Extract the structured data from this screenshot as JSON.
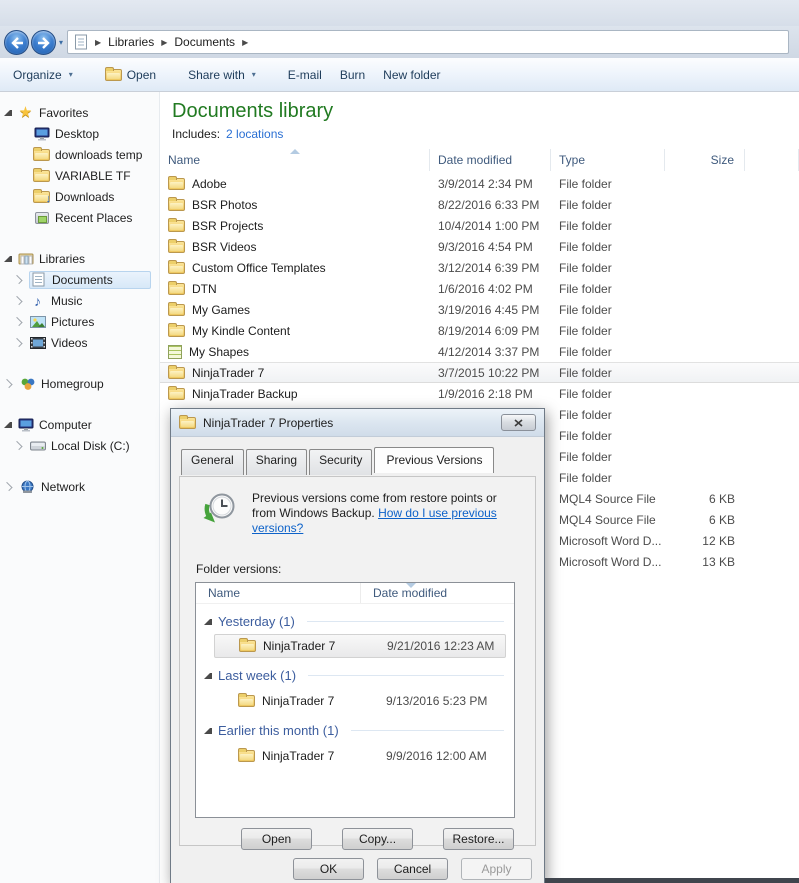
{
  "breadcrumb": {
    "items": [
      "Libraries",
      "Documents"
    ]
  },
  "toolbar": {
    "organize": "Organize",
    "open": "Open",
    "share": "Share with",
    "email": "E-mail",
    "burn": "Burn",
    "new_folder": "New folder"
  },
  "sidebar": {
    "favorites": {
      "label": "Favorites",
      "items": [
        {
          "label": "Desktop"
        },
        {
          "label": "downloads temp"
        },
        {
          "label": "VARIABLE TF"
        },
        {
          "label": "Downloads"
        },
        {
          "label": "Recent Places"
        }
      ]
    },
    "libraries": {
      "label": "Libraries",
      "items": [
        {
          "label": "Documents"
        },
        {
          "label": "Music"
        },
        {
          "label": "Pictures"
        },
        {
          "label": "Videos"
        }
      ]
    },
    "homegroup": {
      "label": "Homegroup"
    },
    "computer": {
      "label": "Computer",
      "items": [
        {
          "label": "Local Disk (C:)"
        }
      ]
    },
    "network": {
      "label": "Network"
    }
  },
  "main": {
    "title": "Documents library",
    "includes_label": "Includes:",
    "includes_link": "2 locations",
    "columns": {
      "name": "Name",
      "date": "Date modified",
      "type": "Type",
      "size": "Size"
    },
    "files": [
      {
        "name": "Adobe",
        "date": "3/9/2014 2:34 PM",
        "type": "File folder",
        "size": "",
        "cls": ""
      },
      {
        "name": "BSR Photos",
        "date": "8/22/2016 6:33 PM",
        "type": "File folder",
        "size": "",
        "cls": ""
      },
      {
        "name": "BSR Projects",
        "date": "10/4/2014 1:00 PM",
        "type": "File folder",
        "size": "",
        "cls": ""
      },
      {
        "name": "BSR Videos",
        "date": "9/3/2016 4:54 PM",
        "type": "File folder",
        "size": "",
        "cls": ""
      },
      {
        "name": "Custom Office Templates",
        "date": "3/12/2014 6:39 PM",
        "type": "File folder",
        "size": "",
        "cls": ""
      },
      {
        "name": "DTN",
        "date": "1/6/2016 4:02 PM",
        "type": "File folder",
        "size": "",
        "cls": ""
      },
      {
        "name": "My Games",
        "date": "3/19/2016 4:45 PM",
        "type": "File folder",
        "size": "",
        "cls": ""
      },
      {
        "name": "My Kindle Content",
        "date": "8/19/2014 6:09 PM",
        "type": "File folder",
        "size": "",
        "cls": ""
      },
      {
        "name": "My Shapes",
        "date": "4/12/2014 3:37 PM",
        "type": "File folder",
        "size": "",
        "cls": "shapes"
      },
      {
        "name": "NinjaTrader 7",
        "date": "3/7/2015 10:22 PM",
        "type": "File folder",
        "size": "",
        "cls": "selected"
      },
      {
        "name": "NinjaTrader Backup",
        "date": "1/9/2016 2:18 PM",
        "type": "File folder",
        "size": "",
        "cls": ""
      },
      {
        "name": "",
        "date": "",
        "type": "File folder",
        "size": "",
        "cls": "noicon"
      },
      {
        "name": "",
        "date": "",
        "type": "File folder",
        "size": "",
        "cls": "noicon"
      },
      {
        "name": "",
        "date": "",
        "type": "File folder",
        "size": "",
        "cls": "noicon"
      },
      {
        "name": "",
        "date": "",
        "type": "File folder",
        "size": "",
        "cls": "noicon"
      },
      {
        "name": "",
        "date": "",
        "type": "MQL4 Source File",
        "size": "6 KB",
        "cls": "noicon"
      },
      {
        "name": "",
        "date": "",
        "type": "MQL4 Source File",
        "size": "6 KB",
        "cls": "noicon"
      },
      {
        "name": "",
        "date": "",
        "type": "Microsoft Word D...",
        "size": "12 KB",
        "cls": "noicon"
      },
      {
        "name": "",
        "date": "",
        "type": "Microsoft Word D...",
        "size": "13 KB",
        "cls": "noicon"
      }
    ]
  },
  "dialog": {
    "title": "NinjaTrader 7 Properties",
    "tabs": {
      "general": "General",
      "sharing": "Sharing",
      "security": "Security",
      "previous": "Previous Versions"
    },
    "intro_text": "Previous versions come from restore points or from Windows Backup.",
    "intro_link": "How do I use previous versions?",
    "folder_versions_label": "Folder versions:",
    "list_columns": {
      "name": "Name",
      "date": "Date modified"
    },
    "groups": [
      {
        "label": "Yesterday (1)",
        "items": [
          {
            "name": "NinjaTrader 7",
            "date": "9/21/2016 12:23 AM"
          }
        ]
      },
      {
        "label": "Last week (1)",
        "items": [
          {
            "name": "NinjaTrader 7",
            "date": "9/13/2016 5:23 PM"
          }
        ]
      },
      {
        "label": "Earlier this month (1)",
        "items": [
          {
            "name": "NinjaTrader 7",
            "date": "9/9/2016 12:00 AM"
          }
        ]
      }
    ],
    "buttons": {
      "open": "Open",
      "copy": "Copy...",
      "restore": "Restore...",
      "ok": "OK",
      "cancel": "Cancel",
      "apply": "Apply"
    }
  },
  "colors": {
    "library_title_green": "#217a21",
    "link_blue": "#0d62c9",
    "toolbar_text": "#1e3c5a",
    "group_header_blue": "#3c5d9e",
    "folder_yellow": "#eec75f"
  }
}
